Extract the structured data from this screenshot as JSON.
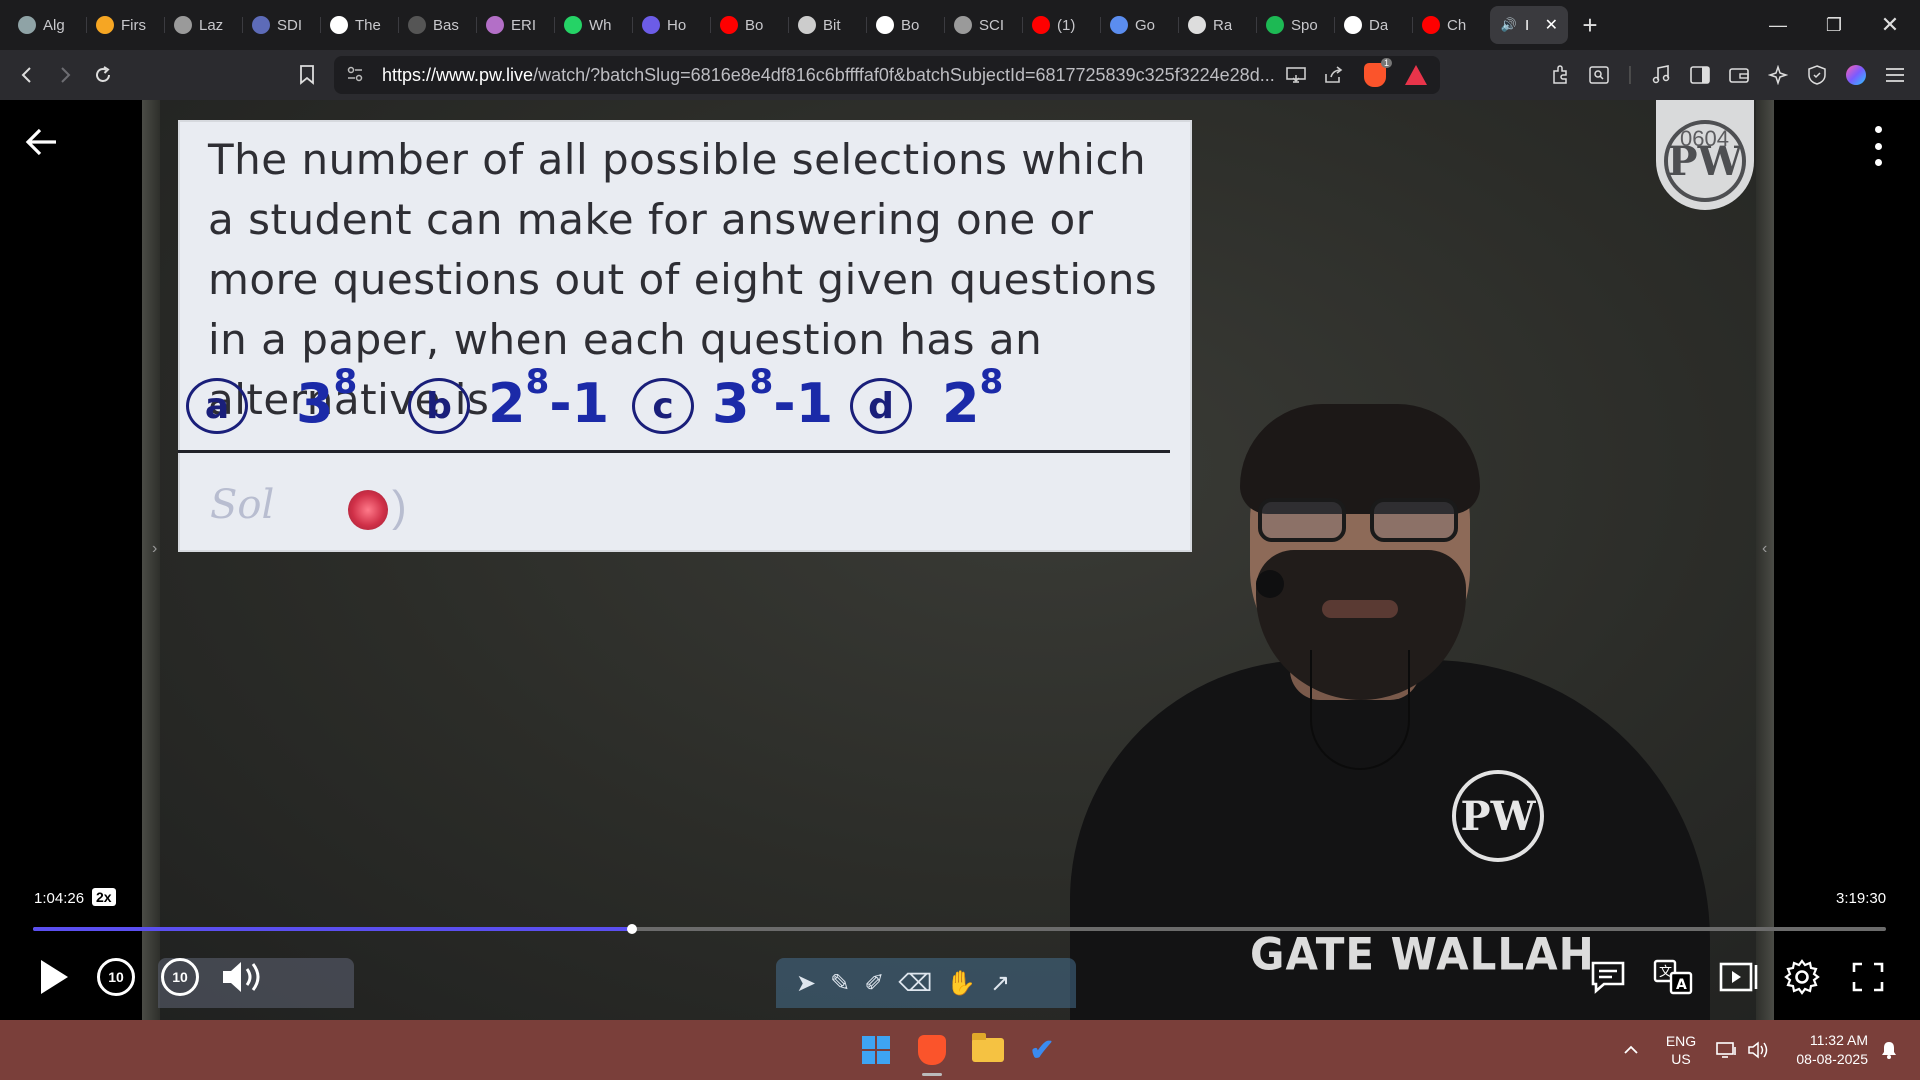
{
  "browser": {
    "tabs": [
      {
        "label": "Alg",
        "icon": "chatgpt-icon",
        "color": "#8fa3a6"
      },
      {
        "label": "Firs",
        "icon": "firstcry-icon",
        "color": "#f6a623"
      },
      {
        "label": "Laz",
        "icon": "globe-icon",
        "color": "#9a9a9a"
      },
      {
        "label": "SDI",
        "icon": "sdi-icon",
        "color": "#5d6bb8"
      },
      {
        "label": "The",
        "icon": "w3schools-icon",
        "color": "#ffffff"
      },
      {
        "label": "Bas",
        "icon": "bas-icon",
        "color": "#555555"
      },
      {
        "label": "ERI",
        "icon": "brain-icon",
        "color": "#b36fc7"
      },
      {
        "label": "Wh",
        "icon": "whatsapp-icon",
        "color": "#25d366"
      },
      {
        "label": "Ho",
        "icon": "bookmark-purple-icon",
        "color": "#6c5ce7"
      },
      {
        "label": "Bo",
        "icon": "youtube-icon",
        "color": "#ff0000"
      },
      {
        "label": "Bit",
        "icon": "bitly-icon",
        "color": "#cccccc"
      },
      {
        "label": "Bo",
        "icon": "google-icon",
        "color": "#ffffff"
      },
      {
        "label": "SCI",
        "icon": "globe-icon",
        "color": "#9a9a9a"
      },
      {
        "label": "(1)",
        "icon": "youtube-icon",
        "color": "#ff0000"
      },
      {
        "label": "Go",
        "icon": "gemini-icon",
        "color": "#5b8def"
      },
      {
        "label": "Ra",
        "icon": "openai-icon",
        "color": "#dddddd"
      },
      {
        "label": "Spo",
        "icon": "spotify-icon",
        "color": "#1db954"
      },
      {
        "label": "Da",
        "icon": "wikipedia-icon",
        "color": "#ffffff"
      },
      {
        "label": "Ch",
        "icon": "youtube-icon",
        "color": "#ff0000"
      }
    ],
    "active_tab": {
      "label": "I",
      "icon": "speaker-icon"
    },
    "url_host": "https://www.pw.live",
    "url_rest": "/watch/?batchSlug=6816e8e4df816c6bffffaf0f&batchSubjectId=6817725839c325f3224e28d...",
    "brave_badge": "1"
  },
  "video": {
    "question": "The number of all possible selections which a student can make for answering one or more questions out of eight given questions in a paper, when each question has an alternative is",
    "options": [
      {
        "letter": "a",
        "base": "3",
        "exp": "8",
        "suffix": ""
      },
      {
        "letter": "b",
        "base": "2",
        "exp": "8",
        "suffix": "-1"
      },
      {
        "letter": "c",
        "base": "3",
        "exp": "8",
        "suffix": "-1"
      },
      {
        "letter": "d",
        "base": "2",
        "exp": "8",
        "suffix": ""
      }
    ],
    "sol_label": "Sol",
    "logo_number": "0604",
    "shirt_text": "GATE WALLAH",
    "current_time": "1:04:26",
    "speed": "2x",
    "total_time": "3:19:30",
    "progress": 0.3234,
    "skip_back_label": "10",
    "skip_forward_label": "10"
  },
  "taskbar": {
    "lang_line1": "ENG",
    "lang_line2": "US",
    "time": "11:32 AM",
    "date": "08-08-2025"
  },
  "colors": {
    "progress_fill": "#5b4ff0",
    "taskbar_bg": "#7a3f3a",
    "ink_blue": "#1b2aa8"
  }
}
